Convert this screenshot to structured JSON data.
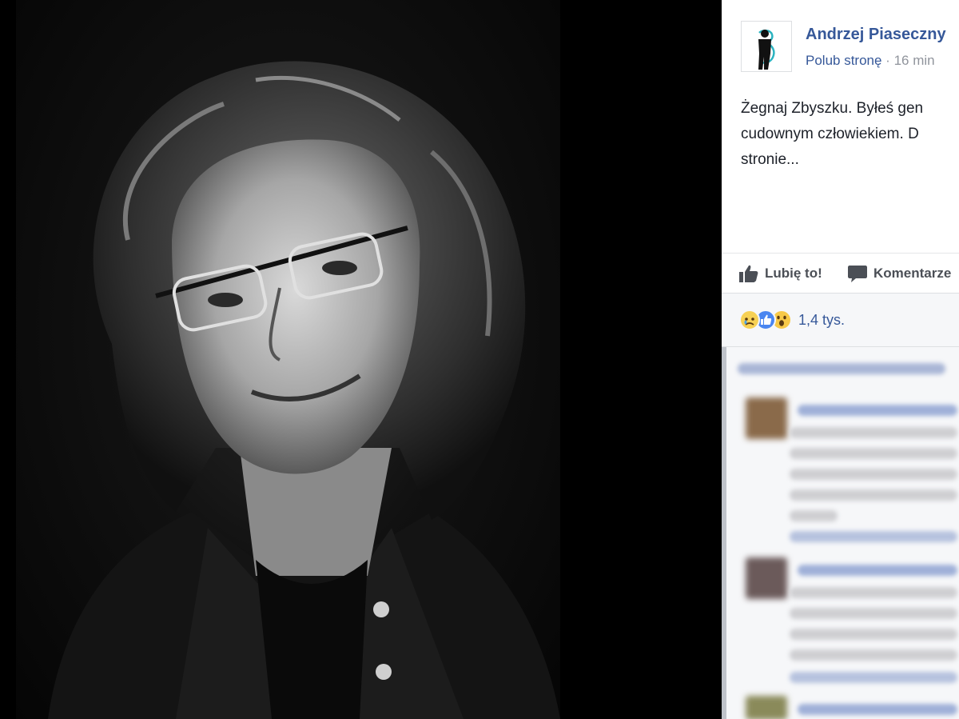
{
  "post": {
    "page_name": "Andrzej Piaseczny",
    "like_page": "Polub stronę",
    "separator": " · ",
    "time": "16 min",
    "text": "Żegnaj Zbyszku. Byłeś gen\ncudownym człowiekiem. D\nstronie..."
  },
  "actions": {
    "like": "Lubię to!",
    "comment": "Komentarze"
  },
  "reactions": {
    "types": [
      "sad",
      "like",
      "wow"
    ],
    "count": "1,4 tys."
  },
  "colors": {
    "link": "#365899",
    "text": "#1d2129",
    "muted": "#90949c",
    "panel_bg": "#ffffff",
    "comments_bg": "#f6f7f9"
  },
  "icons": {
    "like": "thumbs-up-icon",
    "comment": "speech-bubble-icon"
  }
}
